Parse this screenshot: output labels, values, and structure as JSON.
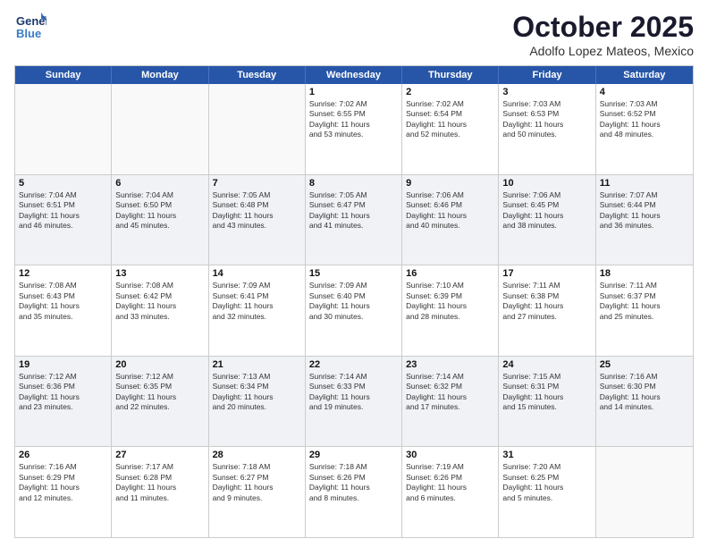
{
  "header": {
    "logo_line1": "General",
    "logo_line2": "Blue",
    "month": "October 2025",
    "location": "Adolfo Lopez Mateos, Mexico"
  },
  "weekdays": [
    "Sunday",
    "Monday",
    "Tuesday",
    "Wednesday",
    "Thursday",
    "Friday",
    "Saturday"
  ],
  "rows": [
    [
      {
        "day": "",
        "text": ""
      },
      {
        "day": "",
        "text": ""
      },
      {
        "day": "",
        "text": ""
      },
      {
        "day": "1",
        "text": "Sunrise: 7:02 AM\nSunset: 6:55 PM\nDaylight: 11 hours\nand 53 minutes."
      },
      {
        "day": "2",
        "text": "Sunrise: 7:02 AM\nSunset: 6:54 PM\nDaylight: 11 hours\nand 52 minutes."
      },
      {
        "day": "3",
        "text": "Sunrise: 7:03 AM\nSunset: 6:53 PM\nDaylight: 11 hours\nand 50 minutes."
      },
      {
        "day": "4",
        "text": "Sunrise: 7:03 AM\nSunset: 6:52 PM\nDaylight: 11 hours\nand 48 minutes."
      }
    ],
    [
      {
        "day": "5",
        "text": "Sunrise: 7:04 AM\nSunset: 6:51 PM\nDaylight: 11 hours\nand 46 minutes."
      },
      {
        "day": "6",
        "text": "Sunrise: 7:04 AM\nSunset: 6:50 PM\nDaylight: 11 hours\nand 45 minutes."
      },
      {
        "day": "7",
        "text": "Sunrise: 7:05 AM\nSunset: 6:48 PM\nDaylight: 11 hours\nand 43 minutes."
      },
      {
        "day": "8",
        "text": "Sunrise: 7:05 AM\nSunset: 6:47 PM\nDaylight: 11 hours\nand 41 minutes."
      },
      {
        "day": "9",
        "text": "Sunrise: 7:06 AM\nSunset: 6:46 PM\nDaylight: 11 hours\nand 40 minutes."
      },
      {
        "day": "10",
        "text": "Sunrise: 7:06 AM\nSunset: 6:45 PM\nDaylight: 11 hours\nand 38 minutes."
      },
      {
        "day": "11",
        "text": "Sunrise: 7:07 AM\nSunset: 6:44 PM\nDaylight: 11 hours\nand 36 minutes."
      }
    ],
    [
      {
        "day": "12",
        "text": "Sunrise: 7:08 AM\nSunset: 6:43 PM\nDaylight: 11 hours\nand 35 minutes."
      },
      {
        "day": "13",
        "text": "Sunrise: 7:08 AM\nSunset: 6:42 PM\nDaylight: 11 hours\nand 33 minutes."
      },
      {
        "day": "14",
        "text": "Sunrise: 7:09 AM\nSunset: 6:41 PM\nDaylight: 11 hours\nand 32 minutes."
      },
      {
        "day": "15",
        "text": "Sunrise: 7:09 AM\nSunset: 6:40 PM\nDaylight: 11 hours\nand 30 minutes."
      },
      {
        "day": "16",
        "text": "Sunrise: 7:10 AM\nSunset: 6:39 PM\nDaylight: 11 hours\nand 28 minutes."
      },
      {
        "day": "17",
        "text": "Sunrise: 7:11 AM\nSunset: 6:38 PM\nDaylight: 11 hours\nand 27 minutes."
      },
      {
        "day": "18",
        "text": "Sunrise: 7:11 AM\nSunset: 6:37 PM\nDaylight: 11 hours\nand 25 minutes."
      }
    ],
    [
      {
        "day": "19",
        "text": "Sunrise: 7:12 AM\nSunset: 6:36 PM\nDaylight: 11 hours\nand 23 minutes."
      },
      {
        "day": "20",
        "text": "Sunrise: 7:12 AM\nSunset: 6:35 PM\nDaylight: 11 hours\nand 22 minutes."
      },
      {
        "day": "21",
        "text": "Sunrise: 7:13 AM\nSunset: 6:34 PM\nDaylight: 11 hours\nand 20 minutes."
      },
      {
        "day": "22",
        "text": "Sunrise: 7:14 AM\nSunset: 6:33 PM\nDaylight: 11 hours\nand 19 minutes."
      },
      {
        "day": "23",
        "text": "Sunrise: 7:14 AM\nSunset: 6:32 PM\nDaylight: 11 hours\nand 17 minutes."
      },
      {
        "day": "24",
        "text": "Sunrise: 7:15 AM\nSunset: 6:31 PM\nDaylight: 11 hours\nand 15 minutes."
      },
      {
        "day": "25",
        "text": "Sunrise: 7:16 AM\nSunset: 6:30 PM\nDaylight: 11 hours\nand 14 minutes."
      }
    ],
    [
      {
        "day": "26",
        "text": "Sunrise: 7:16 AM\nSunset: 6:29 PM\nDaylight: 11 hours\nand 12 minutes."
      },
      {
        "day": "27",
        "text": "Sunrise: 7:17 AM\nSunset: 6:28 PM\nDaylight: 11 hours\nand 11 minutes."
      },
      {
        "day": "28",
        "text": "Sunrise: 7:18 AM\nSunset: 6:27 PM\nDaylight: 11 hours\nand 9 minutes."
      },
      {
        "day": "29",
        "text": "Sunrise: 7:18 AM\nSunset: 6:26 PM\nDaylight: 11 hours\nand 8 minutes."
      },
      {
        "day": "30",
        "text": "Sunrise: 7:19 AM\nSunset: 6:26 PM\nDaylight: 11 hours\nand 6 minutes."
      },
      {
        "day": "31",
        "text": "Sunrise: 7:20 AM\nSunset: 6:25 PM\nDaylight: 11 hours\nand 5 minutes."
      },
      {
        "day": "",
        "text": ""
      }
    ]
  ]
}
